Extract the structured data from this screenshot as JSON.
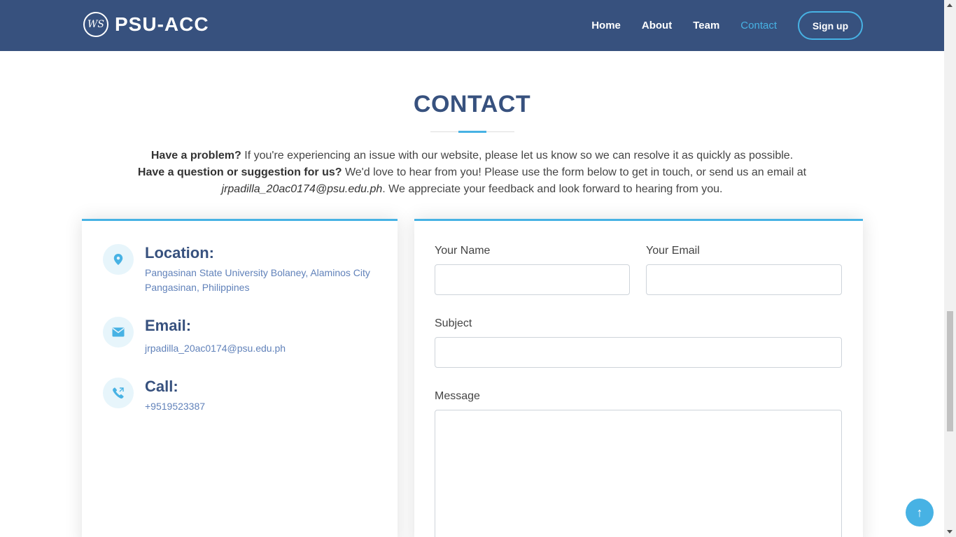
{
  "header": {
    "logo_mark": "WS",
    "logo_text": "PSU-ACC",
    "nav": [
      {
        "label": "Home",
        "active": false
      },
      {
        "label": "About",
        "active": false
      },
      {
        "label": "Team",
        "active": false
      },
      {
        "label": "Contact",
        "active": true
      }
    ],
    "signup_label": "Sign up"
  },
  "section": {
    "title": "CONTACT",
    "intro_q1": "Have a problem?",
    "intro_t1": " If you're experiencing an issue with our website, please let us know so we can resolve it as quickly as possible.",
    "intro_q2": "Have a question or suggestion for us?",
    "intro_t2": " We'd love to hear from you! Please use the form below to get in touch, or send us an email at",
    "intro_email": "jrpadilla_20ac0174@psu.edu.ph",
    "intro_t3": ". We appreciate your feedback and look forward to hearing from you."
  },
  "info": {
    "location_title": "Location:",
    "location_text": "Pangasinan State University Bolaney, Alaminos City Pangasinan, Philippines",
    "email_title": "Email:",
    "email_text": "jrpadilla_20ac0174@psu.edu.ph",
    "call_title": "Call:",
    "call_text": "+9519523387",
    "icons": [
      "map-pin-icon",
      "envelope-icon",
      "phone-icon"
    ]
  },
  "form": {
    "name_label": "Your Name",
    "name_value": "",
    "email_label": "Your Email",
    "email_value": "",
    "subject_label": "Subject",
    "subject_value": "",
    "message_label": "Message",
    "message_value": ""
  },
  "colors": {
    "header_bg": "#37517e",
    "accent": "#47b2e4",
    "title": "#37517e",
    "info_text": "#6182ba"
  },
  "back_to_top": "↑"
}
